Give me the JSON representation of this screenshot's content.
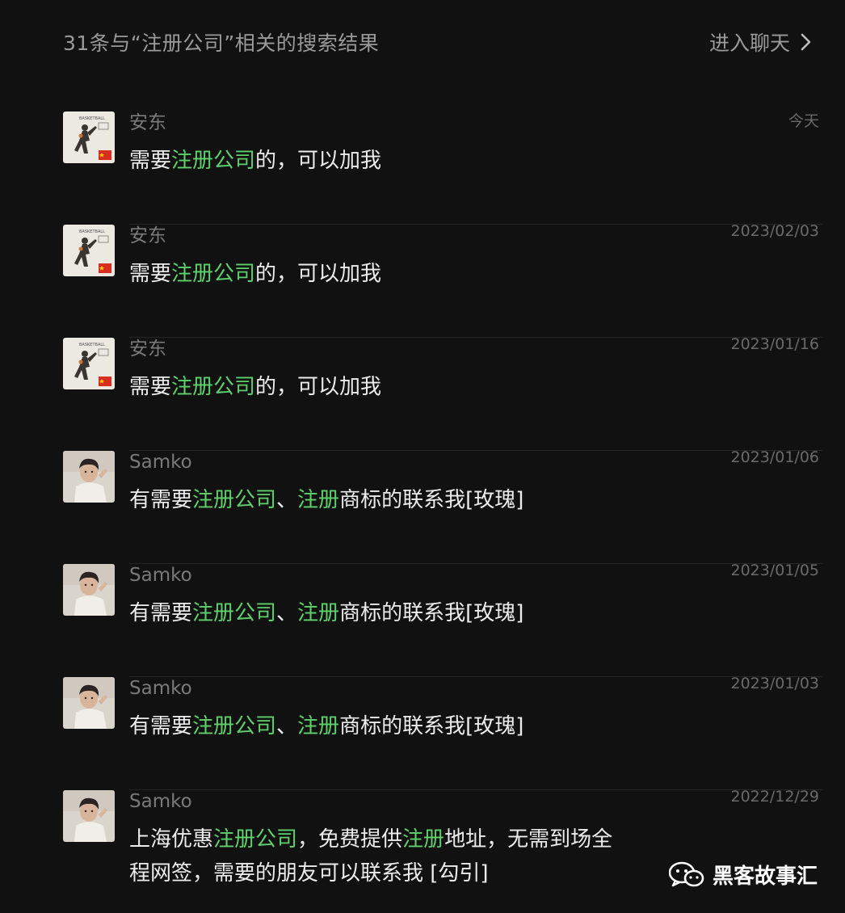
{
  "header": {
    "title": "31条与“注册公司”相关的搜索结果",
    "enter_chat": "进入聊天"
  },
  "results": [
    {
      "sender": "安东",
      "time": "今天",
      "avatar": "basketball-avatar",
      "message": [
        {
          "t": "需要"
        },
        {
          "t": "注册公司",
          "hl": true
        },
        {
          "t": "的，可以加我"
        }
      ]
    },
    {
      "sender": "安东",
      "time": "2023/02/03",
      "avatar": "basketball-avatar",
      "message": [
        {
          "t": "需要"
        },
        {
          "t": "注册公司",
          "hl": true
        },
        {
          "t": "的，可以加我"
        }
      ]
    },
    {
      "sender": "安东",
      "time": "2023/01/16",
      "avatar": "basketball-avatar",
      "message": [
        {
          "t": "需要"
        },
        {
          "t": "注册公司",
          "hl": true
        },
        {
          "t": "的，可以加我"
        }
      ]
    },
    {
      "sender": "Samko",
      "time": "2023/01/06",
      "avatar": "person-avatar",
      "message": [
        {
          "t": "有需要"
        },
        {
          "t": "注册公司",
          "hl": true
        },
        {
          "t": "、"
        },
        {
          "t": "注册",
          "hl": true
        },
        {
          "t": "商标的联系我[玫瑰]"
        }
      ]
    },
    {
      "sender": "Samko",
      "time": "2023/01/05",
      "avatar": "person-avatar",
      "message": [
        {
          "t": "有需要"
        },
        {
          "t": "注册公司",
          "hl": true
        },
        {
          "t": "、"
        },
        {
          "t": "注册",
          "hl": true
        },
        {
          "t": "商标的联系我[玫瑰]"
        }
      ]
    },
    {
      "sender": "Samko",
      "time": "2023/01/03",
      "avatar": "person-avatar",
      "message": [
        {
          "t": "有需要"
        },
        {
          "t": "注册公司",
          "hl": true
        },
        {
          "t": "、"
        },
        {
          "t": "注册",
          "hl": true
        },
        {
          "t": "商标的联系我[玫瑰]"
        }
      ]
    },
    {
      "sender": "Samko",
      "time": "2022/12/29",
      "avatar": "person-avatar",
      "message": [
        {
          "t": "上海优惠"
        },
        {
          "t": "注册公司",
          "hl": true
        },
        {
          "t": "，免费提供"
        },
        {
          "t": "注册",
          "hl": true
        },
        {
          "t": "地址，无需到场全程网签，需要的朋友可以联系我 [勾引]"
        }
      ]
    }
  ],
  "watermark": {
    "text": "黑客故事汇",
    "icon": "wechat-icon"
  },
  "colors": {
    "background": "#111111",
    "highlight": "#5fd16c",
    "muted": "#7a7a7a"
  }
}
